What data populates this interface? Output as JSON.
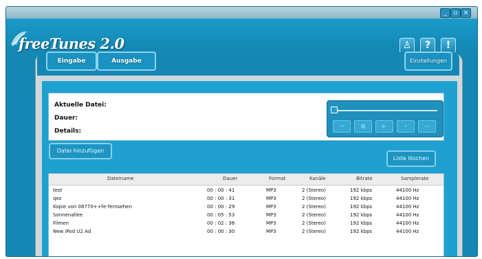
{
  "window": {
    "minimize_glyph": "_",
    "maximize_glyph": "▫",
    "close_glyph": "×"
  },
  "app": {
    "title": "freeTunes 2.0"
  },
  "header_icons": [
    {
      "name": "user-icon",
      "glyph": "♙"
    },
    {
      "name": "help-icon",
      "glyph": "?"
    },
    {
      "name": "info-icon",
      "glyph": "!"
    }
  ],
  "tabs": {
    "eingabe": "Eingabe",
    "ausgabe": "Ausgabe",
    "einstellungen": "Einstellungen"
  },
  "info": {
    "current_file_label": "Aktuelle Datei:",
    "duration_label": "Dauer:",
    "details_label": "Details:"
  },
  "player": {
    "progress": 0.0,
    "buttons": [
      "⏮",
      "■",
      "▶",
      "⏸",
      "⏭"
    ]
  },
  "actions": {
    "add_file": "Datei hinzufügen",
    "delete_list": "Liste löschen"
  },
  "table": {
    "columns": [
      "Dateiname",
      "Dauer",
      "Format",
      "Kanäle",
      "Bitrate",
      "Samplerate"
    ],
    "rows": [
      [
        "test",
        "00 : 00 : 41",
        "MP3",
        "2 (Stereo)",
        "192 kbps",
        "44100 Hz"
      ],
      [
        "qez",
        "00 : 00 : 31",
        "MP3",
        "2 (Stereo)",
        "192 kbps",
        "44100 Hz"
      ],
      [
        "Kopie von 08770++fe-fernsehen",
        "00 : 00 : 29",
        "MP3",
        "2 (Stereo)",
        "192 kbps",
        "44100 Hz"
      ],
      [
        "Sonnenallee",
        "00 : 05 : 53",
        "MP3",
        "2 (Stereo)",
        "192 kbps",
        "44100 Hz"
      ],
      [
        "Filmen",
        "00 : 02 : 36",
        "MP3",
        "2 (Stereo)",
        "192 kbps",
        "44100 Hz"
      ],
      [
        "New iPod U2 Ad",
        "00 : 00 : 30",
        "MP3",
        "2 (Stereo)",
        "192 kbps",
        "44100 Hz"
      ]
    ]
  }
}
